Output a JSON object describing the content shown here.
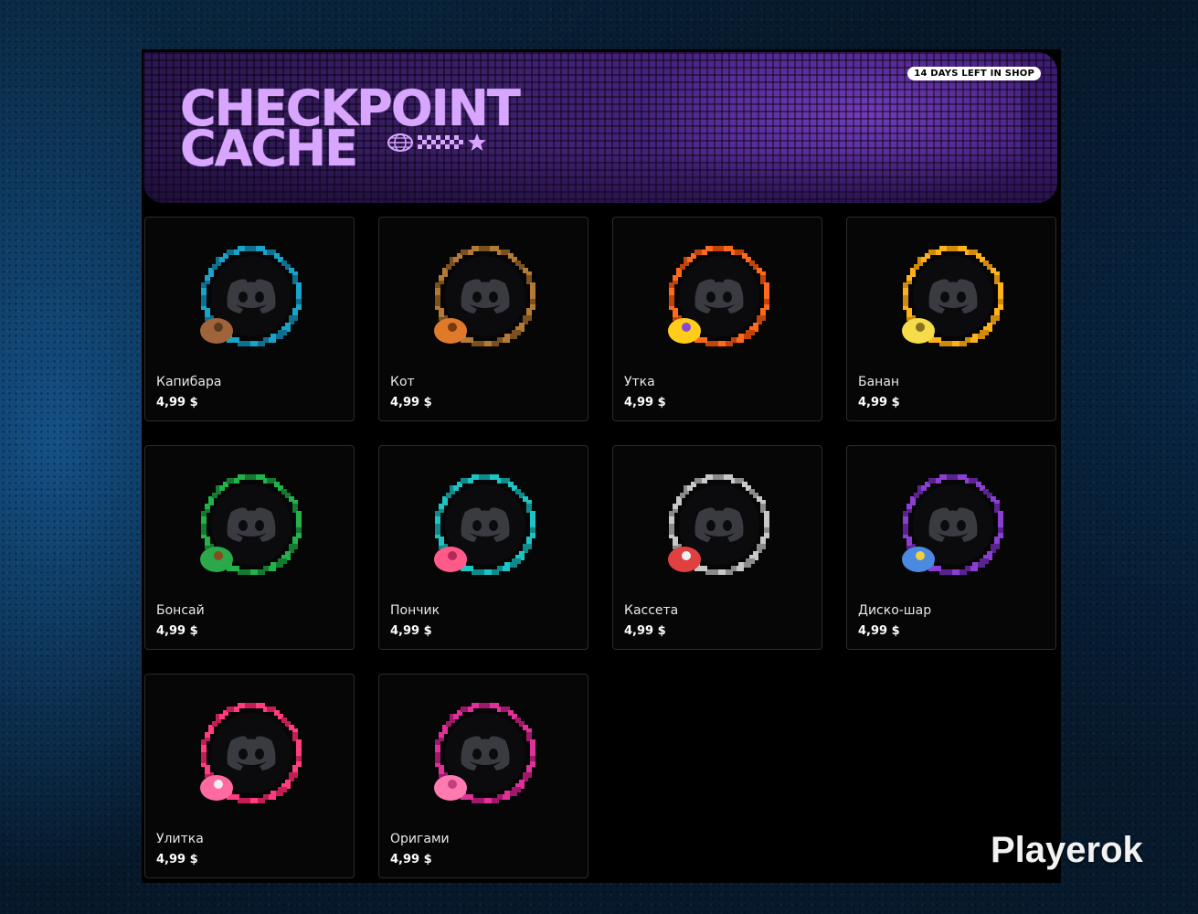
{
  "banner": {
    "title_line1": "CHECKPOINT",
    "title_line2": "CACHE",
    "days_left": "14 DAYS LEFT IN SHOP",
    "title_color": "#d8a5ff"
  },
  "items": [
    {
      "name": "Капибара",
      "price": "4,99 $",
      "ring_color": "#1aa3c8",
      "ring_color2": "#0f6f8f",
      "decoration_icon": "capybara-icon"
    },
    {
      "name": "Кот",
      "price": "4,99 $",
      "ring_color": "#b27a36",
      "ring_color2": "#7a5020",
      "decoration_icon": "cat-icon"
    },
    {
      "name": "Утка",
      "price": "4,99 $",
      "ring_color": "#ff6a1a",
      "ring_color2": "#c2430a",
      "decoration_icon": "duck-icon"
    },
    {
      "name": "Банан",
      "price": "4,99 $",
      "ring_color": "#ffb11a",
      "ring_color2": "#d08a0a",
      "decoration_icon": "banana-icon"
    },
    {
      "name": "Бонсай",
      "price": "4,99 $",
      "ring_color": "#22b24a",
      "ring_color2": "#137a30",
      "decoration_icon": "bonsai-icon"
    },
    {
      "name": "Пончик",
      "price": "4,99 $",
      "ring_color": "#1ec4c4",
      "ring_color2": "#0f8a8a",
      "decoration_icon": "donut-icon"
    },
    {
      "name": "Кассета",
      "price": "4,99 $",
      "ring_color": "#c8c8c8",
      "ring_color2": "#8a8a8a",
      "decoration_icon": "cassette-icon"
    },
    {
      "name": "Диско-шар",
      "price": "4,99 $",
      "ring_color": "#8b3fd0",
      "ring_color2": "#5a2290",
      "decoration_icon": "disco-ball-icon"
    },
    {
      "name": "Улитка",
      "price": "4,99 $",
      "ring_color": "#ff3d7f",
      "ring_color2": "#c21e55",
      "decoration_icon": "snail-icon"
    },
    {
      "name": "Оригами",
      "price": "4,99 $",
      "ring_color": "#e0309a",
      "ring_color2": "#a0186a",
      "decoration_icon": "origami-crane-icon"
    }
  ],
  "watermark": {
    "text": "Playerok"
  }
}
